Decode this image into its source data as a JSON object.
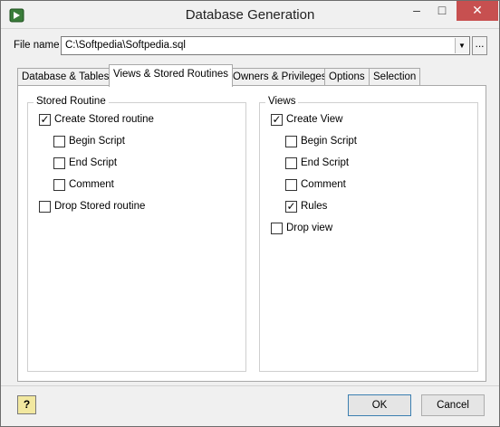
{
  "window": {
    "title": "Database Generation"
  },
  "file": {
    "label": "File name",
    "value": "C:\\Softpedia\\Softpedia.sql",
    "browse": "..."
  },
  "tabs": [
    {
      "label": "Database & Tables"
    },
    {
      "label": "Views & Stored Routines"
    },
    {
      "label": "Owners & Privileges"
    },
    {
      "label": "Options"
    },
    {
      "label": "Selection"
    }
  ],
  "stored_routine": {
    "title": "Stored Routine",
    "items": [
      {
        "label": "Create Stored routine",
        "checked": true
      },
      {
        "label": "Begin Script",
        "checked": false
      },
      {
        "label": "End Script",
        "checked": false
      },
      {
        "label": "Comment",
        "checked": false
      },
      {
        "label": "Drop Stored routine",
        "checked": false
      }
    ]
  },
  "views": {
    "title": "Views",
    "items": [
      {
        "label": "Create View",
        "checked": true
      },
      {
        "label": "Begin Script",
        "checked": false
      },
      {
        "label": "End Script",
        "checked": false
      },
      {
        "label": "Comment",
        "checked": false
      },
      {
        "label": "Rules",
        "checked": true
      },
      {
        "label": "Drop view",
        "checked": false
      }
    ]
  },
  "buttons": {
    "help": "?",
    "ok": "OK",
    "cancel": "Cancel"
  }
}
